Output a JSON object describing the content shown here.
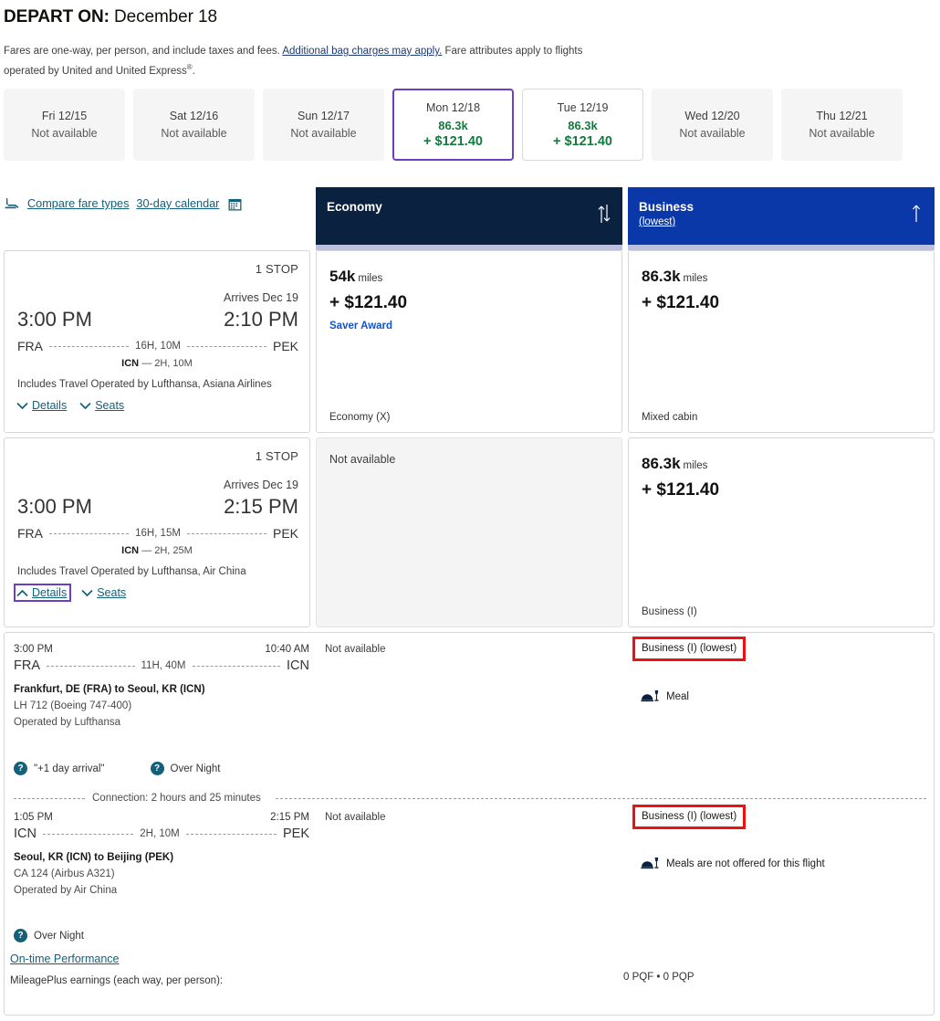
{
  "header": {
    "depart_label": "DEPART ON:",
    "depart_date": "December 18",
    "fare_note_part1": "Fares are one-way, per person, and include taxes and fees. ",
    "fare_note_link": "Additional bag charges may apply.",
    "fare_note_part2": " Fare attributes apply to flights operated by United and United Express",
    "fare_note_sup": "®",
    "fare_note_end": "."
  },
  "date_strip": [
    {
      "label": "Fri 12/15",
      "status": "Not available",
      "miles": "",
      "price": "",
      "state": "unavailable"
    },
    {
      "label": "Sat 12/16",
      "status": "Not available",
      "miles": "",
      "price": "",
      "state": "unavailable"
    },
    {
      "label": "Sun 12/17",
      "status": "Not available",
      "miles": "",
      "price": "",
      "state": "unavailable"
    },
    {
      "label": "Mon 12/18",
      "status": "",
      "miles": "86.3k",
      "price": "+ $121.40",
      "state": "selected"
    },
    {
      "label": "Tue 12/19",
      "status": "",
      "miles": "86.3k",
      "price": "+ $121.40",
      "state": "available"
    },
    {
      "label": "Wed 12/20",
      "status": "Not available",
      "miles": "",
      "price": "",
      "state": "unavailable"
    },
    {
      "label": "Thu 12/21",
      "status": "Not available",
      "miles": "",
      "price": "",
      "state": "unavailable"
    }
  ],
  "toolbar": {
    "compare_fare_types": "Compare fare types",
    "thirty_day_calendar": "30-day calendar"
  },
  "columns": {
    "economy": {
      "name": "Economy",
      "lowest": "",
      "bg": "#0a2240"
    },
    "business": {
      "name": "Business",
      "lowest": "(lowest)",
      "bg": "#0b38a8"
    }
  },
  "flights": [
    {
      "stops": "1 STOP",
      "arrives": "Arrives Dec 19",
      "depart_time": "3:00 PM",
      "arrive_time": "2:10 PM",
      "origin": "FRA",
      "destination": "PEK",
      "duration": "16H, 10M",
      "stop_code": "ICN",
      "stop_layover": "— 2H, 10M",
      "includes": "Includes Travel Operated by Lufthansa, Asiana Airlines",
      "details_label": "Details",
      "seats_label": "Seats",
      "details_expanded": false,
      "economy": {
        "available": true,
        "miles": "54k",
        "miles_unit": "miles",
        "price": "+ $121.40",
        "award": "Saver Award",
        "cabin": "Economy (X)"
      },
      "business": {
        "available": true,
        "miles": "86.3k",
        "miles_unit": "miles",
        "price": "+ $121.40",
        "award": "",
        "cabin": "Mixed cabin"
      }
    },
    {
      "stops": "1 STOP",
      "arrives": "Arrives Dec 19",
      "depart_time": "3:00 PM",
      "arrive_time": "2:15 PM",
      "origin": "FRA",
      "destination": "PEK",
      "duration": "16H, 15M",
      "stop_code": "ICN",
      "stop_layover": "— 2H, 25M",
      "includes": "Includes Travel Operated by Lufthansa, Air China",
      "details_label": "Details",
      "seats_label": "Seats",
      "details_expanded": true,
      "economy": {
        "available": false,
        "not_available": "Not available",
        "miles": "",
        "price": "",
        "cabin": ""
      },
      "business": {
        "available": true,
        "miles": "86.3k",
        "miles_unit": "miles",
        "price": "+ $121.40",
        "award": "",
        "cabin": "Business (I)"
      }
    }
  ],
  "details": {
    "segment1": {
      "depart_time": "3:00 PM",
      "arrive_time": "10:40 AM",
      "origin": "FRA",
      "destination": "ICN",
      "duration": "11H, 40M",
      "city_pair": "Frankfurt, DE (FRA) to Seoul, KR (ICN)",
      "equipment": "LH 712 (Boeing 747-400)",
      "operated_by": "Operated by Lufthansa",
      "badge1": "\"+1 day arrival\"",
      "badge2": "Over Night",
      "economy_status": "Not available",
      "business_fare_code": "Business (I) (lowest)",
      "business_meal": "Meal"
    },
    "connection": "Connection: 2 hours and 25 minutes",
    "segment2": {
      "depart_time": "1:05 PM",
      "arrive_time": "2:15 PM",
      "origin": "ICN",
      "destination": "PEK",
      "duration": "2H, 10M",
      "city_pair": "Seoul, KR (ICN) to Beijing (PEK)",
      "equipment": "CA 124 (Airbus A321)",
      "operated_by": "Operated by Air China",
      "badge1": "Over Night",
      "economy_status": "Not available",
      "business_fare_code": "Business (I) (lowest)",
      "business_meal": "Meals are not offered for this flight"
    },
    "on_time_performance": "On-time Performance",
    "mileageplus_label": "MileagePlus earnings (each way, per person):",
    "pq_values": "0 PQF • 0 PQP"
  },
  "colors": {
    "economy_header": "#0a2240",
    "business_header": "#0b38a8",
    "selected_date_border": "#6b3fbf",
    "price_green": "#137a3e",
    "link_teal": "#14607a",
    "annotation_red": "#ee1111"
  }
}
